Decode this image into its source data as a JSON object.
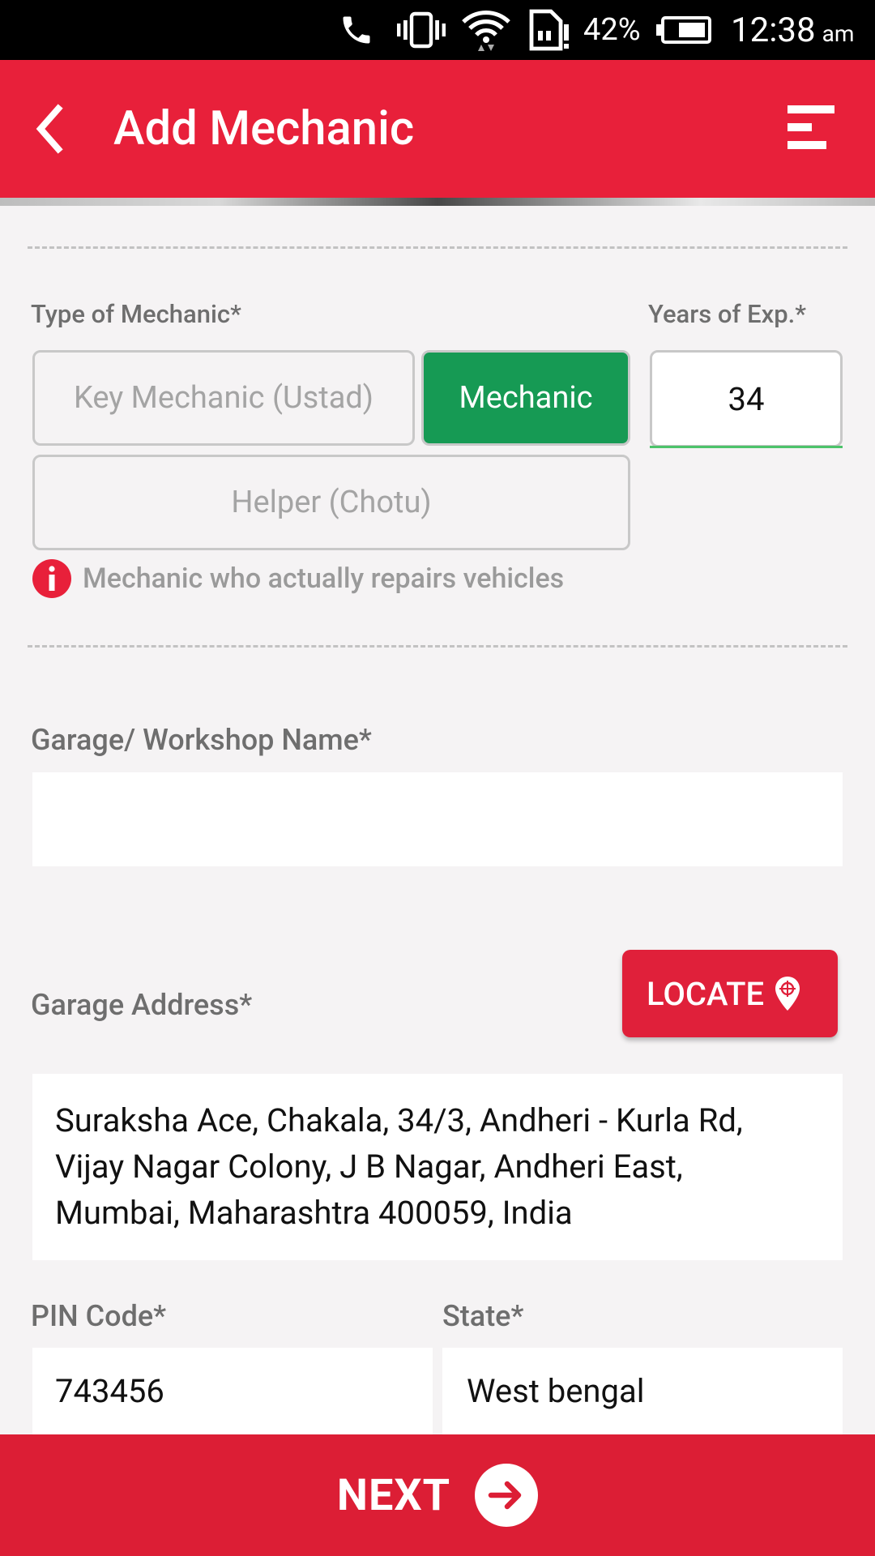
{
  "status_bar": {
    "battery": "42%",
    "time": "12:38",
    "ampm": "am",
    "icons": [
      "phone-call-icon",
      "vibrate-icon",
      "wifi-icon",
      "sim-alert-icon",
      "battery-icon"
    ]
  },
  "app_bar": {
    "title": "Add Mechanic",
    "back_icon": "chevron-left-icon",
    "menu_icon": "menu-icon",
    "background": "#e8203a"
  },
  "mechanic_type": {
    "label": "Type of Mechanic*",
    "options": [
      {
        "label": "Key Mechanic (Ustad)",
        "selected": false
      },
      {
        "label": "Mechanic",
        "selected": true
      },
      {
        "label": "Helper (Chotu)",
        "selected": false
      }
    ],
    "selected_color": "#169a54",
    "info_text": "Mechanic who actually repairs vehicles"
  },
  "experience": {
    "label": "Years of Exp.*",
    "value": "34"
  },
  "garage_name": {
    "label": "Garage/ Workshop Name*",
    "value": ""
  },
  "garage_address": {
    "label": "Garage Address*",
    "locate_label": "LOCATE",
    "value": "Suraksha Ace, Chakala, 34/3, Andheri - Kurla Rd,\nVijay Nagar Colony, J B Nagar, Andheri East,\nMumbai, Maharashtra 400059, India"
  },
  "pin_code": {
    "label": "PIN Code*",
    "value": "743456"
  },
  "state": {
    "label": "State*",
    "value": "West bengal"
  },
  "footer": {
    "next_label": "NEXT",
    "color": "#dc1e35"
  }
}
